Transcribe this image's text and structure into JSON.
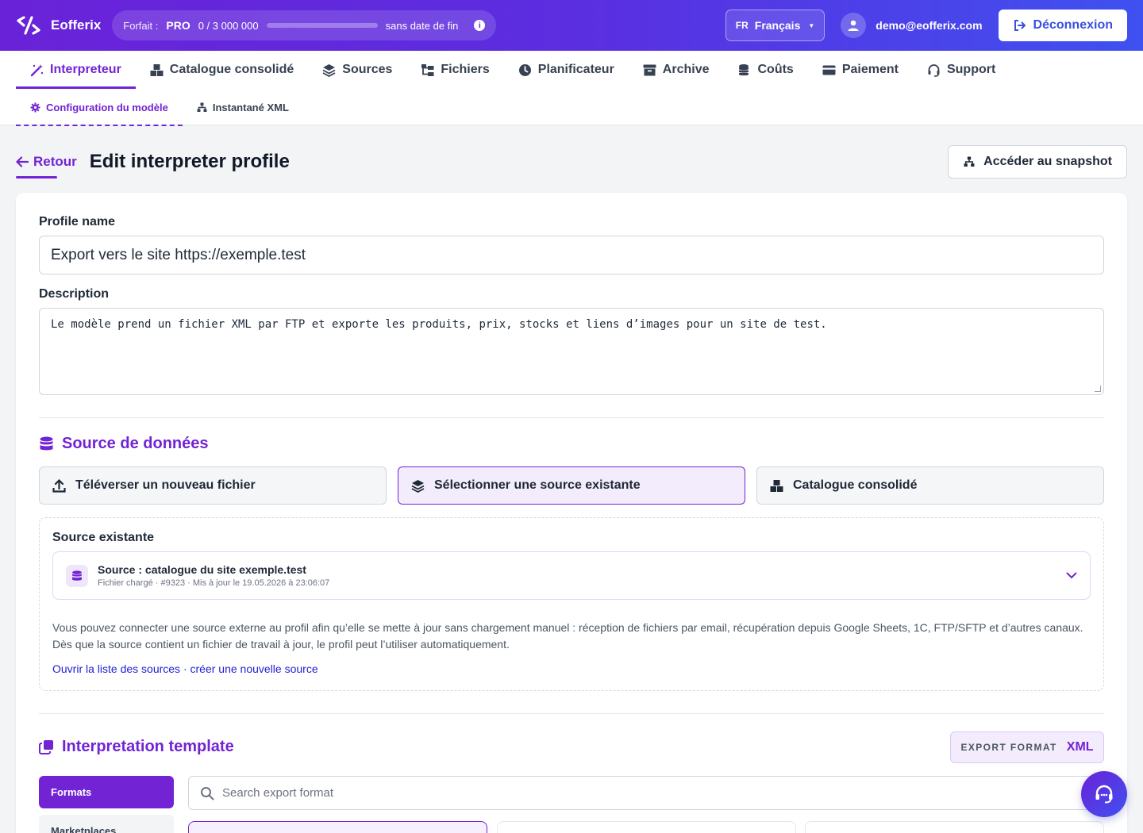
{
  "brand": {
    "name": "Eofferix"
  },
  "plan": {
    "label": "Forfait :",
    "tier": "PRO",
    "usage_text": "0 / 3 000 000",
    "usage_fraction": 0.0,
    "expiry": "sans date de fin"
  },
  "language": {
    "code": "FR",
    "name": "Français"
  },
  "user": {
    "email": "demo@eofferix.com"
  },
  "logout_label": "Déconnexion",
  "nav": {
    "items": [
      {
        "label": "Interpreteur",
        "icon": "magic-wand-icon",
        "active": true
      },
      {
        "label": "Catalogue consolidé",
        "icon": "boxes-icon"
      },
      {
        "label": "Sources",
        "icon": "layers-icon"
      },
      {
        "label": "Fichiers",
        "icon": "folder-tree-icon"
      },
      {
        "label": "Planificateur",
        "icon": "clock-icon"
      },
      {
        "label": "Archive",
        "icon": "archive-icon"
      },
      {
        "label": "Coûts",
        "icon": "coins-icon"
      },
      {
        "label": "Paiement",
        "icon": "credit-card-icon"
      },
      {
        "label": "Support",
        "icon": "headset-icon"
      }
    ],
    "sub_items": [
      {
        "label": "Configuration du modèle",
        "icon": "gear-icon",
        "active": true
      },
      {
        "label": "Instantané XML",
        "icon": "sitemap-icon"
      }
    ]
  },
  "page": {
    "back_label": "Retour",
    "title": "Edit interpreter profile",
    "snapshot_button": "Accéder au snapshot"
  },
  "form": {
    "profile_name_label": "Profile name",
    "profile_name_value": "Export vers le site https://exemple.test",
    "description_label": "Description",
    "description_value": "Le modèle prend un fichier XML par FTP et exporte les produits, prix, stocks et liens d’images pour un site de test."
  },
  "data_source": {
    "title": "Source de données",
    "options": [
      {
        "label": "Téléverser un nouveau fichier",
        "icon": "upload-icon"
      },
      {
        "label": "Sélectionner une source existante",
        "icon": "layers-icon",
        "selected": true
      },
      {
        "label": "Catalogue consolidé",
        "icon": "boxes-icon"
      }
    ],
    "existing_label": "Source existante",
    "selected_source": {
      "name": "Source : catalogue du site exemple.test",
      "meta": "Fichier chargé · #9323 · Mis à jour le 19.05.2026 à 23:06:07"
    },
    "help_text": "Vous pouvez connecter une source externe au profil afin qu’elle se mette à jour sans chargement manuel : réception de fichiers par email, récupération depuis Google Sheets, 1C, FTP/SFTP et d’autres canaux. Dès que la source contient un fichier de travail à jour, le profil peut l’utiliser automatiquement.",
    "link_sources": "Ouvrir la liste des sources",
    "link_separator": " · ",
    "link_new": "créer une nouvelle source"
  },
  "template": {
    "title": "Interpretation template",
    "export_format_key": "EXPORT FORMAT",
    "export_format_value": "XML",
    "tabs": [
      "Formats",
      "Marketplaces"
    ],
    "search_placeholder": "Search export format"
  },
  "colors": {
    "accent": "#7224d4",
    "header_start": "#6a22d8",
    "header_end": "#3f51f0",
    "link": "#1f1fd1"
  }
}
